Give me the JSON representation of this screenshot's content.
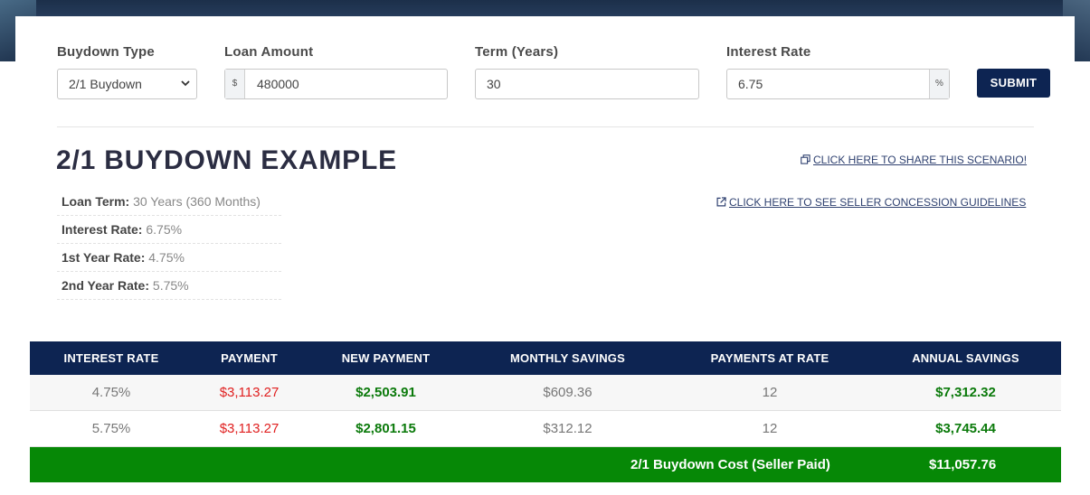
{
  "form": {
    "buydown_type": {
      "label": "Buydown Type",
      "value": "2/1 Buydown"
    },
    "loan_amount": {
      "label": "Loan Amount",
      "prefix": "$",
      "value": "480000"
    },
    "term": {
      "label": "Term (Years)",
      "value": "30"
    },
    "interest_rate": {
      "label": "Interest Rate",
      "value": "6.75",
      "suffix": "%"
    },
    "submit_label": "SUBMIT"
  },
  "example": {
    "title": "2/1 BUYDOWN EXAMPLE",
    "share_link": "CLICK HERE TO SHARE THIS SCENARIO!",
    "guidelines_link": "CLICK HERE TO SEE SELLER CONCESSION GUIDELINES",
    "details": [
      {
        "label": "Loan Term:",
        "value": "30 Years (360 Months)"
      },
      {
        "label": "Interest Rate:",
        "value": "6.75%"
      },
      {
        "label": "1st Year Rate:",
        "value": "4.75%"
      },
      {
        "label": "2nd Year Rate:",
        "value": "5.75%"
      }
    ]
  },
  "table": {
    "headers": [
      "INTEREST RATE",
      "PAYMENT",
      "NEW PAYMENT",
      "MONTHLY SAVINGS",
      "PAYMENTS AT RATE",
      "ANNUAL SAVINGS"
    ],
    "rows": [
      [
        "4.75%",
        "$3,113.27",
        "$2,503.91",
        "$609.36",
        "12",
        "$7,312.32"
      ],
      [
        "5.75%",
        "$3,113.27",
        "$2,801.15",
        "$312.12",
        "12",
        "$3,745.44"
      ]
    ],
    "total_label": "2/1 Buydown Cost (Seller Paid)",
    "total_value": "$11,057.76"
  },
  "colors": {
    "header_bg": "#0d2452",
    "accent_green": "#068806",
    "payment_red": "#e02020",
    "new_payment_green": "#0b7a0b"
  }
}
